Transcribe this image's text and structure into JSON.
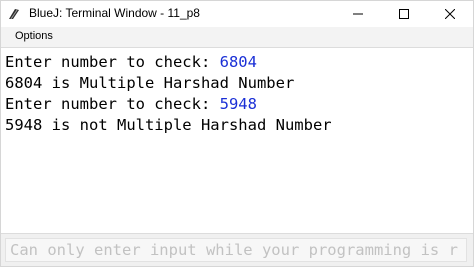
{
  "window": {
    "title": "BlueJ: Terminal Window - 11_p8",
    "icon": "bluej-app-icon",
    "controls": {
      "minimize_icon": "minimize-icon",
      "maximize_icon": "maximize-icon",
      "close_icon": "close-icon"
    }
  },
  "menu": {
    "options_label": "Options"
  },
  "terminal": {
    "lines": [
      {
        "prompt": "Enter number to check: ",
        "input": "6804"
      },
      {
        "text": "6804 is Multiple Harshad Number"
      },
      {
        "prompt": "Enter number to check: ",
        "input": "5948"
      },
      {
        "text": "5948 is not Multiple Harshad Number"
      }
    ]
  },
  "input_field": {
    "placeholder": "Can only enter input while your programming is r"
  },
  "colors": {
    "user_input": "#1a2fd6",
    "output_text": "#000000",
    "placeholder_text": "#c2c2c2"
  }
}
